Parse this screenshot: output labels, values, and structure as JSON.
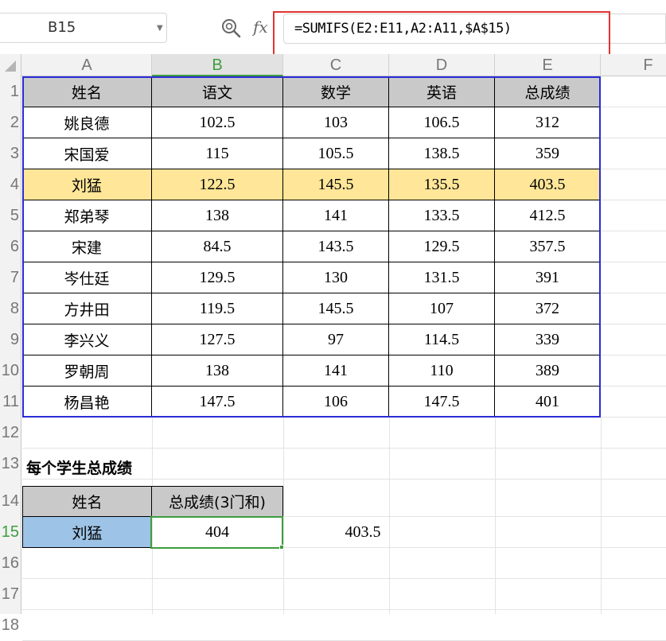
{
  "formula_bar": {
    "cell_ref": "B15",
    "fx_label": "fx",
    "formula": "=SUMIFS(E2:E11,A2:A11,$A$15)"
  },
  "columns": [
    "A",
    "B",
    "C",
    "D",
    "E",
    "F"
  ],
  "rows": [
    "1",
    "2",
    "3",
    "4",
    "5",
    "6",
    "7",
    "8",
    "9",
    "10",
    "11",
    "12",
    "13",
    "14",
    "15",
    "16",
    "17",
    "18"
  ],
  "table": {
    "headers": [
      "姓名",
      "语文",
      "数学",
      "英语",
      "总成绩"
    ],
    "rows": [
      [
        "姚良德",
        "102.5",
        "103",
        "106.5",
        "312"
      ],
      [
        "宋国爱",
        "115",
        "105.5",
        "138.5",
        "359"
      ],
      [
        "刘猛",
        "122.5",
        "145.5",
        "135.5",
        "403.5"
      ],
      [
        "郑弟琴",
        "138",
        "141",
        "133.5",
        "412.5"
      ],
      [
        "宋建",
        "84.5",
        "143.5",
        "129.5",
        "357.5"
      ],
      [
        "岑仕廷",
        "129.5",
        "130",
        "131.5",
        "391"
      ],
      [
        "方井田",
        "119.5",
        "145.5",
        "107",
        "372"
      ],
      [
        "李兴义",
        "127.5",
        "97",
        "114.5",
        "339"
      ],
      [
        "罗朝周",
        "138",
        "141",
        "110",
        "389"
      ],
      [
        "杨昌艳",
        "147.5",
        "106",
        "147.5",
        "401"
      ]
    ]
  },
  "summary": {
    "title": "每个学生总成绩",
    "name_header": "姓名",
    "total_header": "总成绩(3门和)",
    "name_value": "刘猛",
    "total_value": "404",
    "side_value": "403.5"
  },
  "colors": {
    "selection_green": "#3e9d3e",
    "highlight_row": "#ffe699",
    "header_gray": "#c9c9c9",
    "name_cell_blue": "#9dc3e6",
    "table_border_blue": "#2b2bd6",
    "annotation_red": "#e2332f"
  }
}
